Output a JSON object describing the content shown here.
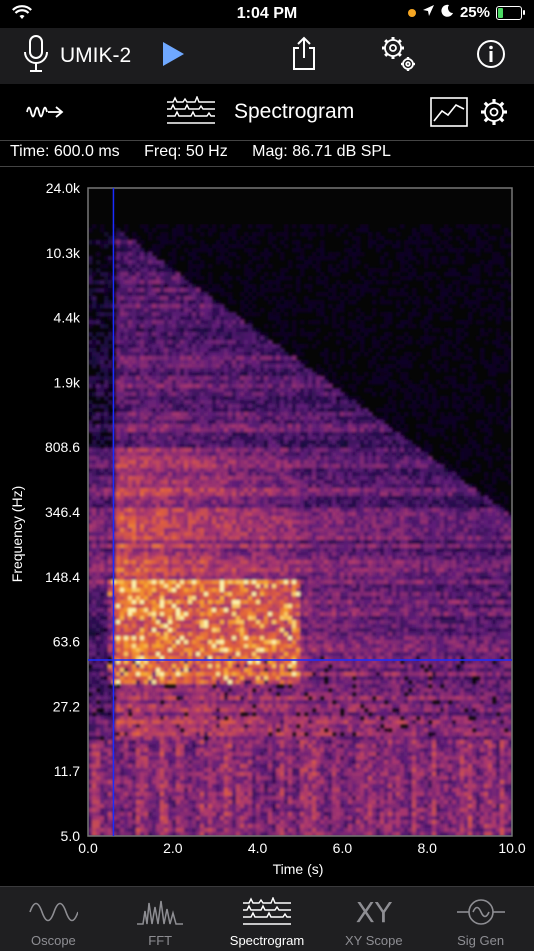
{
  "status": {
    "time": "1:04 PM",
    "battery": "25%",
    "battery_level": 0.25
  },
  "toolbar": {
    "device_name": "UMIK-2"
  },
  "view": {
    "title": "Spectrogram"
  },
  "readout": {
    "time": "Time: 600.0 ms",
    "freq": "Freq: 50 Hz",
    "mag": "Mag: 86.71 dB SPL"
  },
  "chart_data": {
    "type": "heatmap",
    "xlabel": "Time (s)",
    "ylabel": "Frequency (Hz)",
    "xlim": [
      0.0,
      10.0
    ],
    "ylim": [
      5.0,
      24000
    ],
    "yscale": "log",
    "x_ticks": [
      "0.0",
      "2.0",
      "4.0",
      "6.0",
      "8.0",
      "10.0"
    ],
    "y_ticks": [
      "24.0k",
      "10.3k",
      "4.4k",
      "1.9k",
      "808.6",
      "346.4",
      "148.4",
      "63.6",
      "27.2",
      "11.7",
      "5.0"
    ],
    "cursor": {
      "time_s": 0.6,
      "freq_hz": 50
    }
  },
  "tabs": [
    {
      "label": "Oscope",
      "icon": "sine-wave-icon",
      "active": false
    },
    {
      "label": "FFT",
      "icon": "fft-icon",
      "active": false
    },
    {
      "label": "Spectrogram",
      "icon": "spectrogram-icon",
      "active": true
    },
    {
      "label": "XY Scope",
      "icon": "xy-icon",
      "glyph": "XY",
      "active": false
    },
    {
      "label": "Sig Gen",
      "icon": "signal-generator-icon",
      "active": false
    }
  ]
}
